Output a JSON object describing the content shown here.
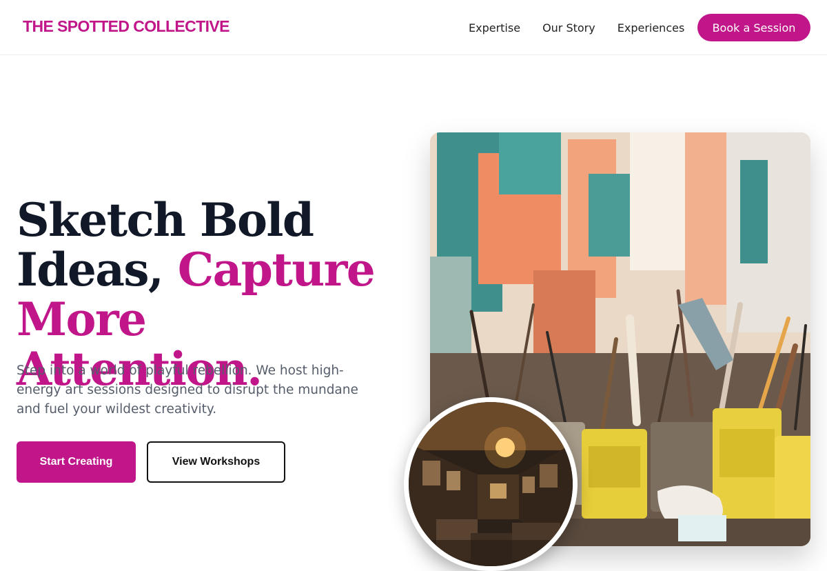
{
  "brand": {
    "name": "THE SPOTTED COLLECTIVE"
  },
  "nav": {
    "links": [
      "Expertise",
      "Our Story",
      "Experiences"
    ],
    "cta": "Book a Session"
  },
  "hero": {
    "headline": {
      "line1": "Sketch Bold",
      "line2_plain": "Ideas, ",
      "line2_accent": "Capture",
      "line3_accent": "More Attention."
    },
    "lede": "Step into a world of playful rebellion. We host high-energy art sessions designed to disrupt the mundane and fuel your wildest creativity.",
    "primary_cta": "Start Creating",
    "secondary_cta": "View Workshops"
  },
  "images": {
    "main": "art-studio-paint-cans-photo",
    "inset": "gallery-room-photo"
  },
  "colors": {
    "accent": "#c0168a",
    "text": "#111827",
    "muted": "#555d6b"
  }
}
